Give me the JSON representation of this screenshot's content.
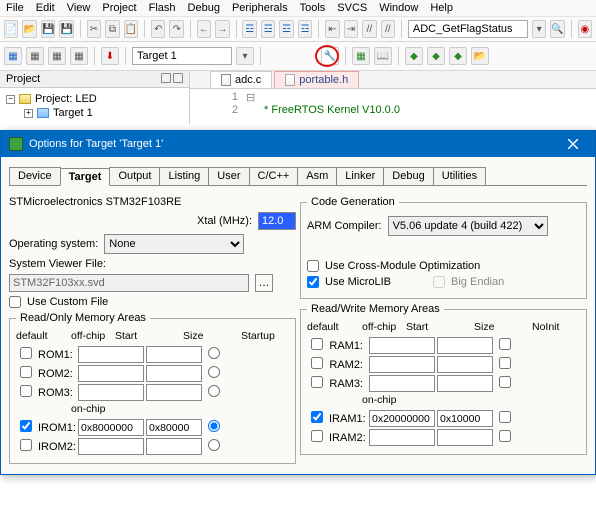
{
  "menubar": [
    "File",
    "Edit",
    "View",
    "Project",
    "Flash",
    "Debug",
    "Peripherals",
    "Tools",
    "SVCS",
    "Window",
    "Help"
  ],
  "toolbar2": {
    "target_combo": "Target 1",
    "find_combo": "ADC_GetFlagStatus"
  },
  "project_pane": {
    "title": "Project",
    "root": "Project: LED",
    "child": "Target 1"
  },
  "editor": {
    "tabs": [
      {
        "name": "adc.c",
        "active": true
      },
      {
        "name": "portable.h",
        "active": false
      }
    ],
    "line1_no": "1",
    "line2_no": "2",
    "line2_text": "FreeRTOS Kernel V10.0.0"
  },
  "dialog": {
    "title": "Options for Target 'Target 1'",
    "tabs": [
      "Device",
      "Target",
      "Output",
      "Listing",
      "User",
      "C/C++",
      "Asm",
      "Linker",
      "Debug",
      "Utilities"
    ],
    "device": "STMicroelectronics STM32F103RE",
    "xtal_label": "Xtal (MHz):",
    "xtal_value": "12.0",
    "os_label": "Operating system:",
    "os_value": "None",
    "svf_label": "System Viewer File:",
    "svf_value": "STM32F103xx.svd",
    "custom_file_label": "Use Custom File",
    "codegen": {
      "legend": "Code Generation",
      "arm_compiler_label": "ARM Compiler:",
      "arm_compiler_value": "V5.06 update 4 (build 422)",
      "cross_module_label": "Use Cross-Module Optimization",
      "microlib_label": "Use MicroLIB",
      "bigendian_label": "Big Endian"
    },
    "ro_legend": "Read/Only Memory Areas",
    "rw_legend": "Read/Write Memory Areas",
    "headers": {
      "default": "default",
      "offchip": "off-chip",
      "start": "Start",
      "size": "Size",
      "startup": "Startup",
      "noinit": "NoInit",
      "onchip": "on-chip"
    },
    "ro_rows": [
      {
        "label": "ROM1:",
        "default": false,
        "start": "",
        "size": "",
        "startup": false
      },
      {
        "label": "ROM2:",
        "default": false,
        "start": "",
        "size": "",
        "startup": false
      },
      {
        "label": "ROM3:",
        "default": false,
        "start": "",
        "size": "",
        "startup": false
      }
    ],
    "ro_onchip": [
      {
        "label": "IROM1:",
        "default": true,
        "start": "0x8000000",
        "size": "0x80000",
        "startup": true
      },
      {
        "label": "IROM2:",
        "default": false,
        "start": "",
        "size": "",
        "startup": false
      }
    ],
    "rw_rows": [
      {
        "label": "RAM1:",
        "default": false,
        "start": "",
        "size": ""
      },
      {
        "label": "RAM2:",
        "default": false,
        "start": "",
        "size": ""
      },
      {
        "label": "RAM3:",
        "default": false,
        "start": "",
        "size": ""
      }
    ],
    "rw_onchip": [
      {
        "label": "IRAM1:",
        "default": true,
        "start": "0x20000000",
        "size": "0x10000"
      },
      {
        "label": "IRAM2:",
        "default": false,
        "start": "",
        "size": ""
      }
    ]
  }
}
